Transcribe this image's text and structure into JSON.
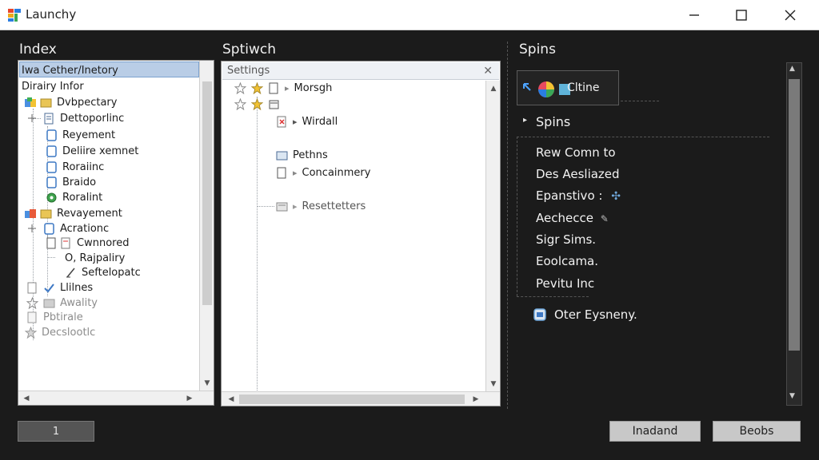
{
  "window": {
    "title": "Launchy",
    "controls": [
      "minimize-icon",
      "maximize-icon",
      "close-icon"
    ]
  },
  "index_panel": {
    "heading": "Index",
    "selected": "Iwa Cether/Inetory",
    "rows": [
      {
        "label": "Iwa Cether/Inetory",
        "icon": "none",
        "dim": false
      },
      {
        "label": "Dirairy Infor",
        "icon": "none",
        "dim": false
      },
      {
        "label": "Dvbpectary",
        "icon": "folder-colorful-icon",
        "dim": false
      },
      {
        "label": "Dettoporlinc",
        "icon": "document-icon",
        "dim": false
      },
      {
        "label": "Reyement",
        "icon": "document-blue-icon",
        "dim": false
      },
      {
        "label": "Deliire xemnet",
        "icon": "document-blue-icon",
        "dim": false
      },
      {
        "label": "Roraiinc",
        "icon": "document-blue-icon",
        "dim": false
      },
      {
        "label": "Braido",
        "icon": "document-blue-icon",
        "dim": false
      },
      {
        "label": "Roralint",
        "icon": "gear-green-icon",
        "dim": false
      },
      {
        "label": "Revayement",
        "icon": "folder-colorful-icon",
        "dim": false
      },
      {
        "label": "Acrationc",
        "icon": "document-blue-icon",
        "dim": false
      },
      {
        "label": "Cwnnored",
        "icon": "document-red-icon",
        "dim": false
      },
      {
        "label": "O, Rajpaliry",
        "icon": "none",
        "dim": false
      },
      {
        "label": "Seftelopatc",
        "icon": "pencil-icon",
        "dim": false
      },
      {
        "label": "Llilnes",
        "icon": "checkmark-icon",
        "dim": false
      },
      {
        "label": "Awality",
        "icon": "folder-gray-icon",
        "dim": true
      },
      {
        "label": "Pbtirale",
        "icon": "document-gray-icon",
        "dim": true
      },
      {
        "label": "Decslootlc",
        "icon": "star-icon",
        "dim": true
      }
    ]
  },
  "settings_panel": {
    "heading": "Sptiwch",
    "header_label": "Settings",
    "rows": [
      {
        "label": "Morsgh",
        "icon": "folder-icon"
      },
      {
        "label": "Wirdall",
        "icon": "document-red-icon"
      },
      {
        "label": "Pethns",
        "icon": "folder-icon"
      },
      {
        "label": "Concainmery",
        "icon": "folder-icon"
      },
      {
        "label": "Resettetters",
        "icon": "folder-gray-icon"
      }
    ]
  },
  "spins_panel": {
    "heading": "Spins",
    "tile_label": "Cltine",
    "section_title": "Spins",
    "items": [
      "Rew Comn to",
      "Des Aesliazed",
      "Epanstivo :",
      "Aechecce",
      "Sigr Sims.",
      "Eoolcama.",
      "Pevitu Inc"
    ],
    "footer_item": "Oter Eysneny."
  },
  "bottom": {
    "page_box": "1",
    "button_left": "Inadand",
    "button_right": "Beobs"
  }
}
